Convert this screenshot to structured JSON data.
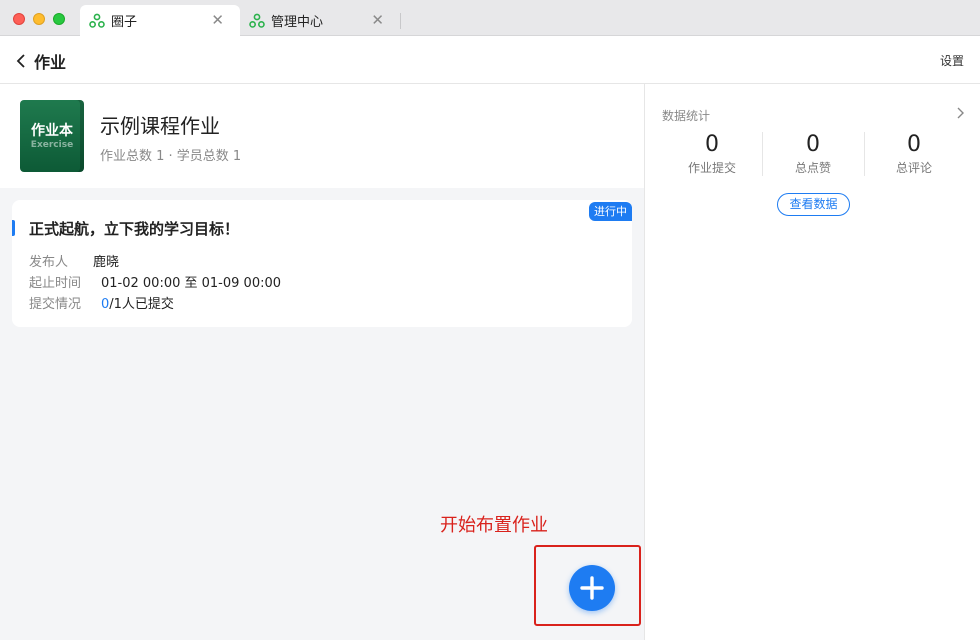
{
  "tabs": [
    {
      "label": "圈子",
      "icon": "circle-group-icon",
      "active": true
    },
    {
      "label": "管理中心",
      "icon": "circle-group-icon",
      "active": false
    }
  ],
  "header": {
    "back_label": "作业",
    "settings_label": "设置"
  },
  "course": {
    "cover_title": "作业本",
    "cover_subtitle": "Exercise",
    "title": "示例课程作业",
    "meta": "作业总数 1 · 学员总数 1"
  },
  "assignment": {
    "title": "正式起航，立下我的学习目标！",
    "status": "进行中",
    "publisher_label": "发布人",
    "publisher": "鹿晓",
    "time_label": "起止时间",
    "time": "01-02 00:00 至 01-09 00:00",
    "submit_label": "提交情况",
    "submitted": "0",
    "submit_rest": "/1人已提交"
  },
  "annotation": {
    "text": "开始布置作业"
  },
  "stats": {
    "title": "数据统计",
    "items": [
      {
        "value": "0",
        "label": "作业提交"
      },
      {
        "value": "0",
        "label": "总点赞"
      },
      {
        "value": "0",
        "label": "总评论"
      }
    ],
    "view_button": "查看数据"
  },
  "colors": {
    "accent": "#1e7cf2",
    "annotation": "#d9221c",
    "tab_icon": "#2bb24c"
  }
}
